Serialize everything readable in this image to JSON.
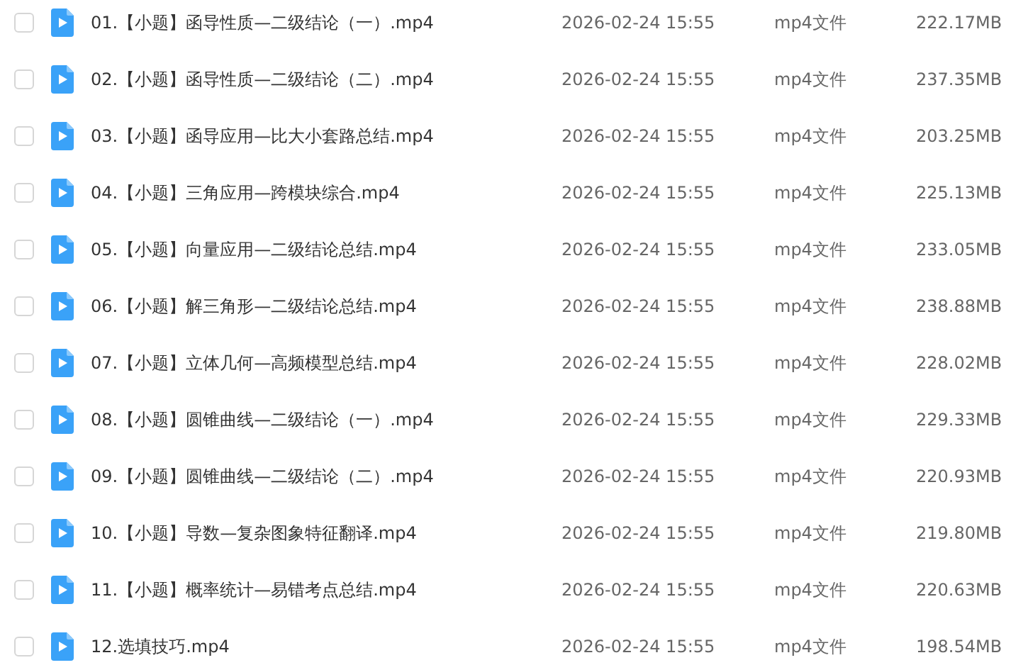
{
  "files": [
    {
      "name": "01.【小题】函导性质—二级结论（一）.mp4",
      "modified": "2026-02-24 15:55",
      "type": "mp4文件",
      "size": "222.17MB",
      "checked": false
    },
    {
      "name": "02.【小题】函导性质—二级结论（二）.mp4",
      "modified": "2026-02-24 15:55",
      "type": "mp4文件",
      "size": "237.35MB",
      "checked": false
    },
    {
      "name": "03.【小题】函导应用—比大小套路总结.mp4",
      "modified": "2026-02-24 15:55",
      "type": "mp4文件",
      "size": "203.25MB",
      "checked": false
    },
    {
      "name": "04.【小题】三角应用—跨模块综合.mp4",
      "modified": "2026-02-24 15:55",
      "type": "mp4文件",
      "size": "225.13MB",
      "checked": false
    },
    {
      "name": "05.【小题】向量应用—二级结论总结.mp4",
      "modified": "2026-02-24 15:55",
      "type": "mp4文件",
      "size": "233.05MB",
      "checked": false
    },
    {
      "name": "06.【小题】解三角形—二级结论总结.mp4",
      "modified": "2026-02-24 15:55",
      "type": "mp4文件",
      "size": "238.88MB",
      "checked": false
    },
    {
      "name": "07.【小题】立体几何—高频模型总结.mp4",
      "modified": "2026-02-24 15:55",
      "type": "mp4文件",
      "size": "228.02MB",
      "checked": false
    },
    {
      "name": "08.【小题】圆锥曲线—二级结论（一）.mp4",
      "modified": "2026-02-24 15:55",
      "type": "mp4文件",
      "size": "229.33MB",
      "checked": false
    },
    {
      "name": "09.【小题】圆锥曲线—二级结论（二）.mp4",
      "modified": "2026-02-24 15:55",
      "type": "mp4文件",
      "size": "220.93MB",
      "checked": false
    },
    {
      "name": "10.【小题】导数—复杂图象特征翻译.mp4",
      "modified": "2026-02-24 15:55",
      "type": "mp4文件",
      "size": "219.80MB",
      "checked": false
    },
    {
      "name": "11.【小题】概率统计—易错考点总结.mp4",
      "modified": "2026-02-24 15:55",
      "type": "mp4文件",
      "size": "220.63MB",
      "checked": false
    },
    {
      "name": "12.选填技巧.mp4",
      "modified": "2026-02-24 15:55",
      "type": "mp4文件",
      "size": "198.54MB",
      "checked": false
    }
  ]
}
